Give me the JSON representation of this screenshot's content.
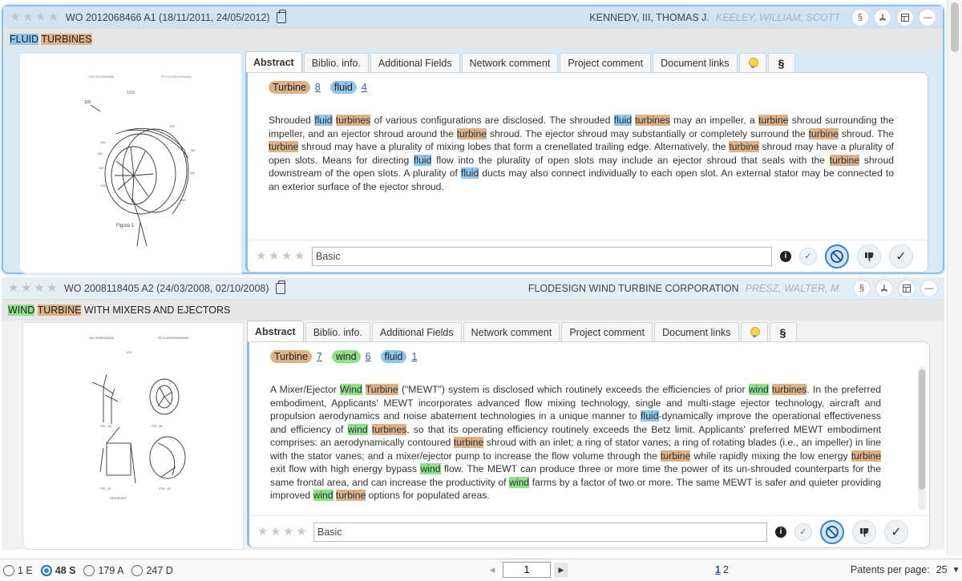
{
  "patents": [
    {
      "number": "WO 2012068466 A1 (18/11/2011, 24/05/2012)",
      "applicant": "KENNEDY, III, THOMAS J.",
      "inventor": "KEELEY, WILLIAM, SCOTT",
      "title_parts": [
        {
          "text": "FLUID",
          "hl": "fluid"
        },
        {
          "text": " ",
          "hl": ""
        },
        {
          "text": "TURBINES",
          "hl": "turbine"
        }
      ],
      "figure_caption": "Figure 1",
      "keywords": [
        {
          "label": "Turbine",
          "count": "8",
          "kind": "turbine"
        },
        {
          "label": "fluid",
          "count": "4",
          "kind": "fluid"
        }
      ],
      "abstract": [
        {
          "t": "Shrouded "
        },
        {
          "t": "fluid",
          "h": "fluid"
        },
        {
          "t": " "
        },
        {
          "t": "turbines",
          "h": "turbine"
        },
        {
          "t": " of various configurations are disclosed. The shrouded "
        },
        {
          "t": "fluid",
          "h": "fluid"
        },
        {
          "t": " "
        },
        {
          "t": "turbines",
          "h": "turbine"
        },
        {
          "t": " may an impeller, a "
        },
        {
          "t": "turbine",
          "h": "turbine"
        },
        {
          "t": " shroud surrounding the impeller, and an ejector shroud around the "
        },
        {
          "t": "turbine",
          "h": "turbine"
        },
        {
          "t": " shroud. The ejector shroud may substantially or completely surround the "
        },
        {
          "t": "turbine",
          "h": "turbine"
        },
        {
          "t": " shroud. The "
        },
        {
          "t": "turbine",
          "h": "turbine"
        },
        {
          "t": " shroud may have a plurality of mixing lobes that form a crenellated trailing edge. Alternatively, the "
        },
        {
          "t": "turbine",
          "h": "turbine"
        },
        {
          "t": " shroud may have a plurality of open slots. Means for directing "
        },
        {
          "t": "fluid",
          "h": "fluid"
        },
        {
          "t": " flow into the plurality of open slots may include an ejector shroud that seals with the "
        },
        {
          "t": "turbine",
          "h": "turbine"
        },
        {
          "t": " shroud downstream of the open slots. A plurality of "
        },
        {
          "t": "fluid",
          "h": "fluid"
        },
        {
          "t": " ducts may also connect individually to each open slot. An external stator may be connected to an exterior surface of the ejector shroud."
        }
      ],
      "comment": "Basic"
    },
    {
      "number": "WO 2008118405 A2 (24/03/2008, 02/10/2008)",
      "applicant": "FLODESIGN WIND TURBINE CORPORATION",
      "inventor": "PRESZ, WALTER, M.",
      "title_parts": [
        {
          "text": "WIND",
          "hl": "wind"
        },
        {
          "text": " ",
          "hl": ""
        },
        {
          "text": "TURBINE",
          "hl": "turbine"
        },
        {
          "text": " WITH MIXERS AND EJECTORS",
          "hl": ""
        }
      ],
      "figure_labels": [
        "FIG. 1A",
        "FIG. 1B",
        "FIG. 1C",
        "FIG. 1D"
      ],
      "keywords": [
        {
          "label": "Turbine",
          "count": "7",
          "kind": "turbine"
        },
        {
          "label": "wind",
          "count": "6",
          "kind": "wind"
        },
        {
          "label": "fluid",
          "count": "1",
          "kind": "fluid"
        }
      ],
      "abstract": [
        {
          "t": "A Mixer/Ejector "
        },
        {
          "t": "Wind",
          "h": "wind"
        },
        {
          "t": " "
        },
        {
          "t": "Turbine",
          "h": "turbine"
        },
        {
          "t": " (\"MEWT\") system is disclosed which routinely exceeds the efficiencies of prior "
        },
        {
          "t": "wind",
          "h": "wind"
        },
        {
          "t": " "
        },
        {
          "t": "turbines",
          "h": "turbine"
        },
        {
          "t": ". In the preferred embodiment, Applicants' MEWT incorporates advanced flow mixing technology, single and multi-stage ejector technology, aircraft and propulsion aerodynamics and noise abatement technologies in a unique manner to "
        },
        {
          "t": "fluid",
          "h": "fluid"
        },
        {
          "t": "-dynamically improve the operational effectiveness and efficiency of "
        },
        {
          "t": "wind",
          "h": "wind"
        },
        {
          "t": " "
        },
        {
          "t": "turbines",
          "h": "turbine"
        },
        {
          "t": ", so that its operating efficiency routinely exceeds the Betz limit. Applicants' preferred MEWT embodiment comprises: an aerodynamically contoured "
        },
        {
          "t": "turbine",
          "h": "turbine"
        },
        {
          "t": " shroud with an inlet; a ring of stator vanes; a ring of rotating blades (i.e., an impeller) in line with the stator vanes; and a mixer/ejector pump to increase the flow volume through the "
        },
        {
          "t": "turbine",
          "h": "turbine"
        },
        {
          "t": " while rapidly mixing the low energy "
        },
        {
          "t": "turbine",
          "h": "turbine"
        },
        {
          "t": " exit flow with high energy bypass "
        },
        {
          "t": "wind",
          "h": "wind"
        },
        {
          "t": " flow. The MEWT can produce three or more time the power of its un-shrouded counterparts for the same frontal area, and can increase the productivity of "
        },
        {
          "t": "wind",
          "h": "wind"
        },
        {
          "t": " farms by a factor of two or more. The same MEWT is safer and quieter providing improved "
        },
        {
          "t": "wind",
          "h": "wind"
        },
        {
          "t": " "
        },
        {
          "t": "turbine",
          "h": "turbine"
        },
        {
          "t": " options for populated areas."
        }
      ],
      "comment": "Basic"
    }
  ],
  "tabs": [
    "Abstract",
    "Biblio. info.",
    "Additional Fields",
    "Network comment",
    "Project comment",
    "Document links"
  ],
  "header_icons": [
    "section-icon",
    "pdf-icon",
    "layout-icon",
    "collapse-icon"
  ],
  "header_glyphs": {
    "section": "§",
    "collapse": "—"
  },
  "info_glyph": "i",
  "tab_section_glyph": "§",
  "filters": [
    {
      "label": "1 E",
      "checked": false
    },
    {
      "label": "48 S",
      "checked": true
    },
    {
      "label": "179 A",
      "checked": false
    },
    {
      "label": "247 D",
      "checked": false
    }
  ],
  "pager": {
    "current": "1",
    "pages": [
      "1",
      "2"
    ]
  },
  "per_page": {
    "label": "Patents per page:",
    "value": "25"
  }
}
